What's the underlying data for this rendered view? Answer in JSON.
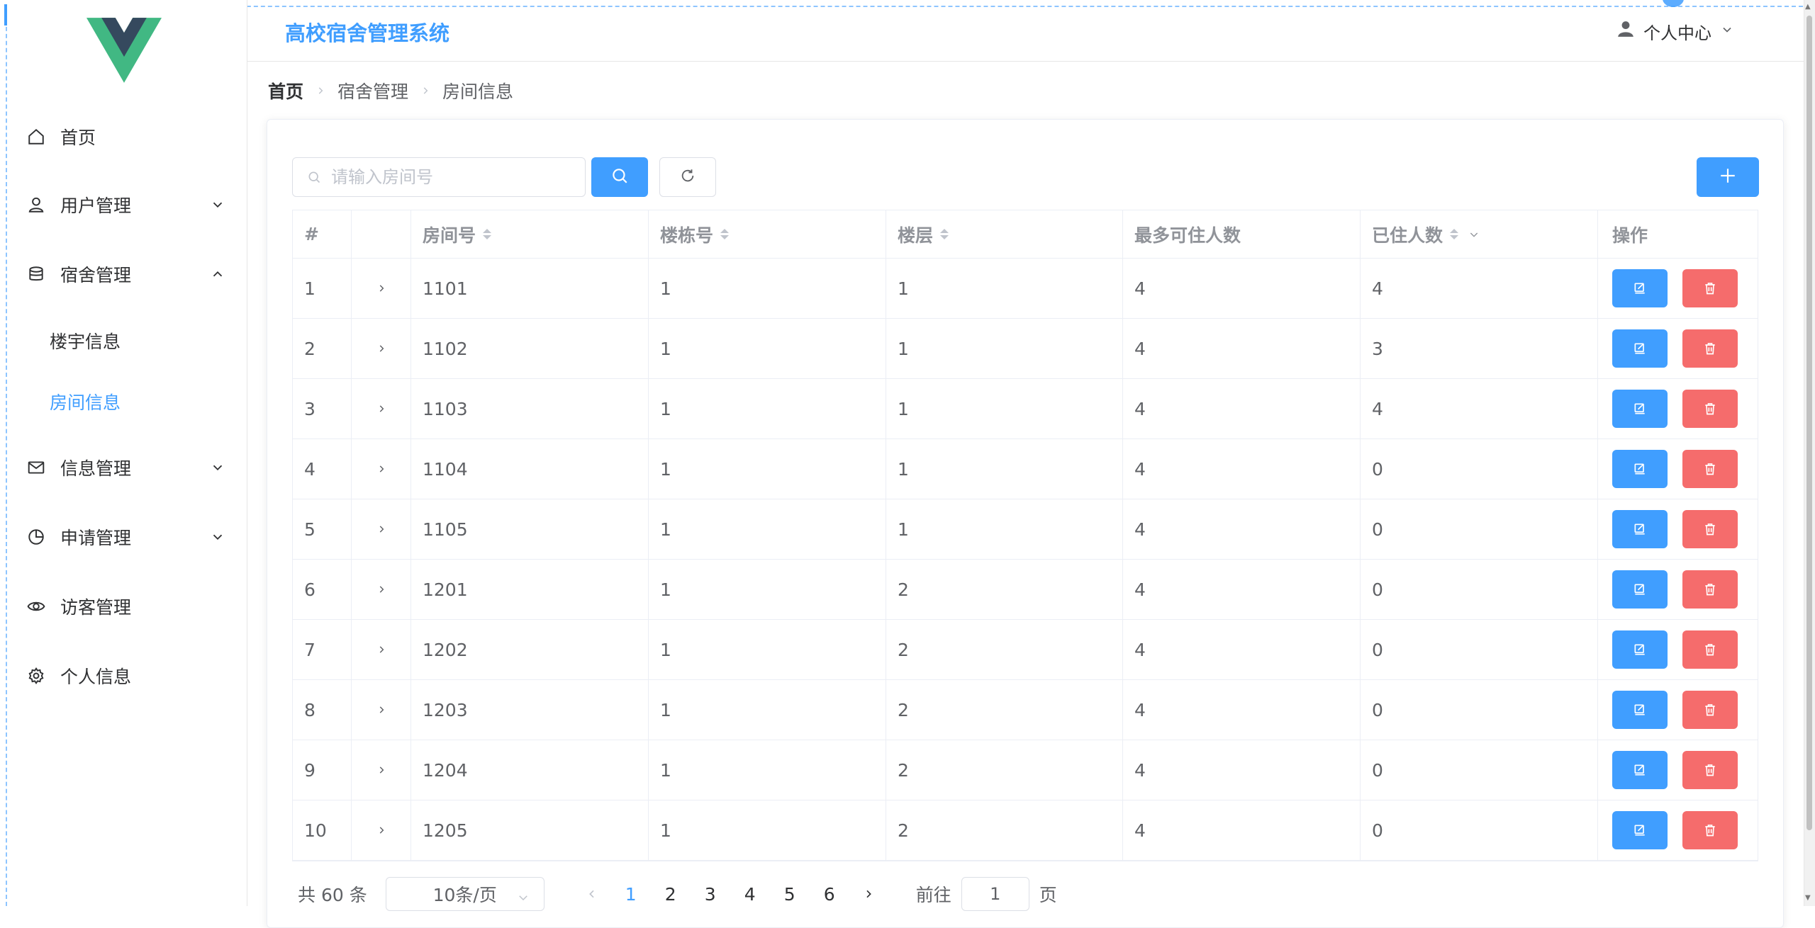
{
  "header": {
    "system_title": "高校宿舍管理系统",
    "user_menu_label": "个人中心"
  },
  "sidebar": {
    "items": [
      {
        "label": "首页",
        "icon": "home-icon"
      },
      {
        "label": "用户管理",
        "icon": "user-icon"
      },
      {
        "label": "宿舍管理",
        "icon": "database-icon"
      },
      {
        "label": "楼宇信息"
      },
      {
        "label": "房间信息"
      },
      {
        "label": "信息管理",
        "icon": "message-icon"
      },
      {
        "label": "申请管理",
        "icon": "pie-chart-icon"
      },
      {
        "label": "访客管理",
        "icon": "view-icon"
      },
      {
        "label": "个人信息",
        "icon": "setting-icon"
      }
    ]
  },
  "breadcrumb": [
    "首页",
    "宿舍管理",
    "房间信息"
  ],
  "search": {
    "placeholder": "请输入房间号",
    "value": ""
  },
  "table": {
    "columns": [
      "#",
      "",
      "房间号",
      "楼栋号",
      "楼层",
      "最多可住人数",
      "已住人数",
      "操作"
    ],
    "rows": [
      [
        "1",
        "1101",
        "1",
        "1",
        "4",
        "4"
      ],
      [
        "2",
        "1102",
        "1",
        "1",
        "4",
        "3"
      ],
      [
        "3",
        "1103",
        "1",
        "1",
        "4",
        "4"
      ],
      [
        "4",
        "1104",
        "1",
        "1",
        "4",
        "0"
      ],
      [
        "5",
        "1105",
        "1",
        "1",
        "4",
        "0"
      ],
      [
        "6",
        "1201",
        "1",
        "2",
        "4",
        "0"
      ],
      [
        "7",
        "1202",
        "1",
        "2",
        "4",
        "0"
      ],
      [
        "8",
        "1203",
        "1",
        "2",
        "4",
        "0"
      ],
      [
        "9",
        "1204",
        "1",
        "2",
        "4",
        "0"
      ],
      [
        "10",
        "1205",
        "1",
        "2",
        "4",
        "0"
      ]
    ]
  },
  "pagination": {
    "total_label": "共 60 条",
    "page_size": "10条/页",
    "pages": [
      "1",
      "2",
      "3",
      "4",
      "5",
      "6"
    ],
    "current_page": "1",
    "goto_prefix": "前往",
    "goto_value": "1",
    "goto_suffix": "页"
  },
  "colors": {
    "primary": "#409eff",
    "danger": "#f56c6c",
    "logo_green": "#41b883",
    "logo_dark": "#35495e"
  }
}
